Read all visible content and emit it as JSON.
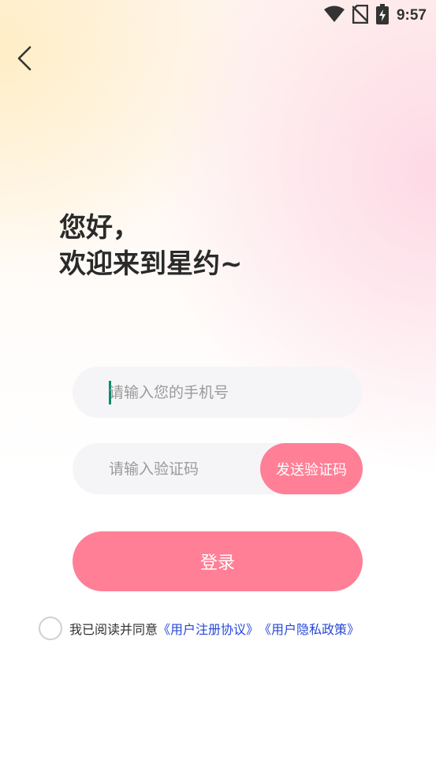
{
  "status_bar": {
    "time": "9:57",
    "icons": [
      "wifi-icon",
      "no-sim-icon",
      "battery-charging-icon"
    ]
  },
  "header": {
    "back_icon": "chevron-left-icon"
  },
  "greeting": {
    "line1": "您好，",
    "line2": "欢迎来到星约~"
  },
  "phone_field": {
    "placeholder": "请输入您的手机号",
    "value": ""
  },
  "code_field": {
    "placeholder": "请输入验证码",
    "value": "",
    "send_button_label": "发送验证码"
  },
  "login_button": {
    "label": "登录"
  },
  "agreement": {
    "checked": false,
    "prefix": "我已阅读并同意",
    "user_agreement": "《用户注册协议》",
    "privacy_policy": "《用户隐私政策》"
  },
  "colors": {
    "accent": "#ff7f96",
    "link": "#2748d8",
    "field_bg": "#f5f5f7",
    "cursor": "#0a8a6e"
  }
}
